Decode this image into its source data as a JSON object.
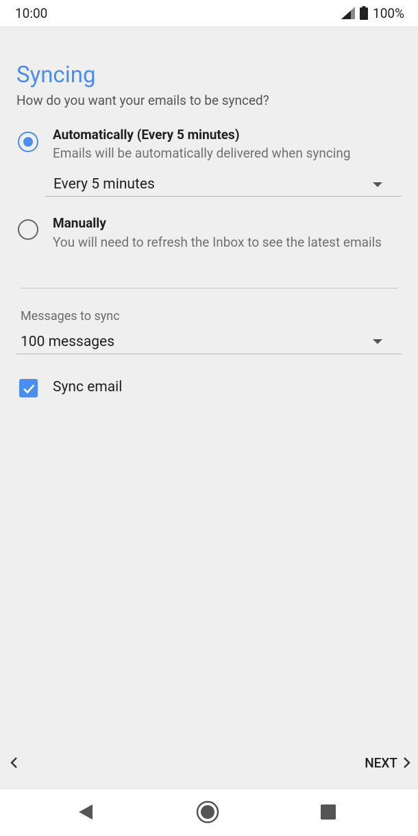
{
  "status_bar": {
    "time": "10:00",
    "battery": "100%"
  },
  "page": {
    "title": "Syncing",
    "subtitle": "How do you want your emails to be synced?"
  },
  "sync_options": [
    {
      "title": "Automatically (Every 5 minutes)",
      "description": "Emails will be automatically delivered when syncing",
      "selected": true
    },
    {
      "title": "Manually",
      "description": "You will need to refresh the Inbox to see the latest emails",
      "selected": false
    }
  ],
  "frequency_select": {
    "value": "Every 5 minutes"
  },
  "messages_to_sync": {
    "label": "Messages to sync",
    "value": "100 messages"
  },
  "sync_email": {
    "label": "Sync email",
    "checked": true
  },
  "footer": {
    "next_label": "NEXT"
  },
  "colors": {
    "accent": "#4a8ef2",
    "background": "#efefef",
    "text": "#202020",
    "secondary_text": "#707070"
  },
  "icons": [
    "signal-icon",
    "battery-icon",
    "chevron-left-icon",
    "chevron-right-icon",
    "nav-back-icon",
    "nav-home-icon",
    "nav-recents-icon",
    "dropdown-caret-icon",
    "check-icon"
  ]
}
